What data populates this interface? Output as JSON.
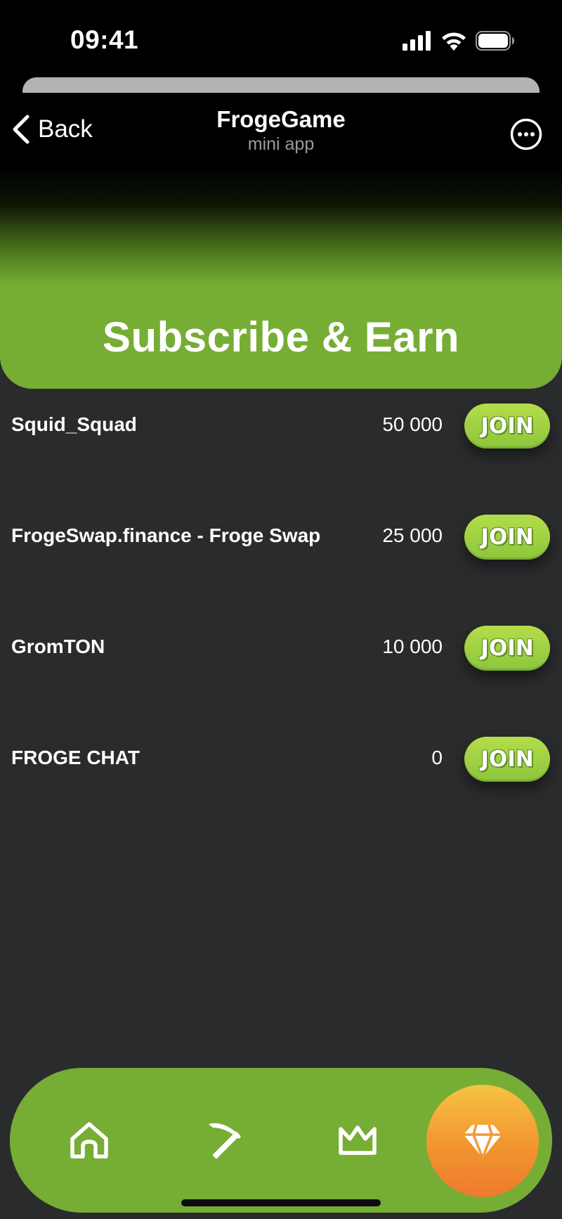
{
  "status_bar": {
    "time": "09:41",
    "icons": [
      "cellular-signal-icon",
      "wifi-icon",
      "battery-icon"
    ]
  },
  "header": {
    "back_label": "Back",
    "title": "FrogeGame",
    "subtitle": "mini app",
    "icons": [
      "chevron-left-icon",
      "more-options-icon"
    ]
  },
  "banner": {
    "title": "Subscribe & Earn"
  },
  "channels": [
    {
      "name": "Squid_Squad",
      "amount": "50 000",
      "button": "JOIN"
    },
    {
      "name": "FrogeSwap.finance - Froge Swap",
      "amount": "25 000",
      "button": "JOIN"
    },
    {
      "name": "GromTON",
      "amount": "10 000",
      "button": "JOIN"
    },
    {
      "name": "FROGE CHAT",
      "amount": "0",
      "button": "JOIN"
    }
  ],
  "bottom_nav": {
    "items": [
      "home-icon",
      "pickaxe-icon",
      "crown-icon",
      "gem-icon"
    ],
    "active": "gem-icon"
  },
  "colors": {
    "accent_green": "#76ad35",
    "join_green": "#9ccf3f",
    "background": "#2a2b2d",
    "active_gem_gradient": [
      "#f5c343",
      "#ee7a2e"
    ]
  }
}
